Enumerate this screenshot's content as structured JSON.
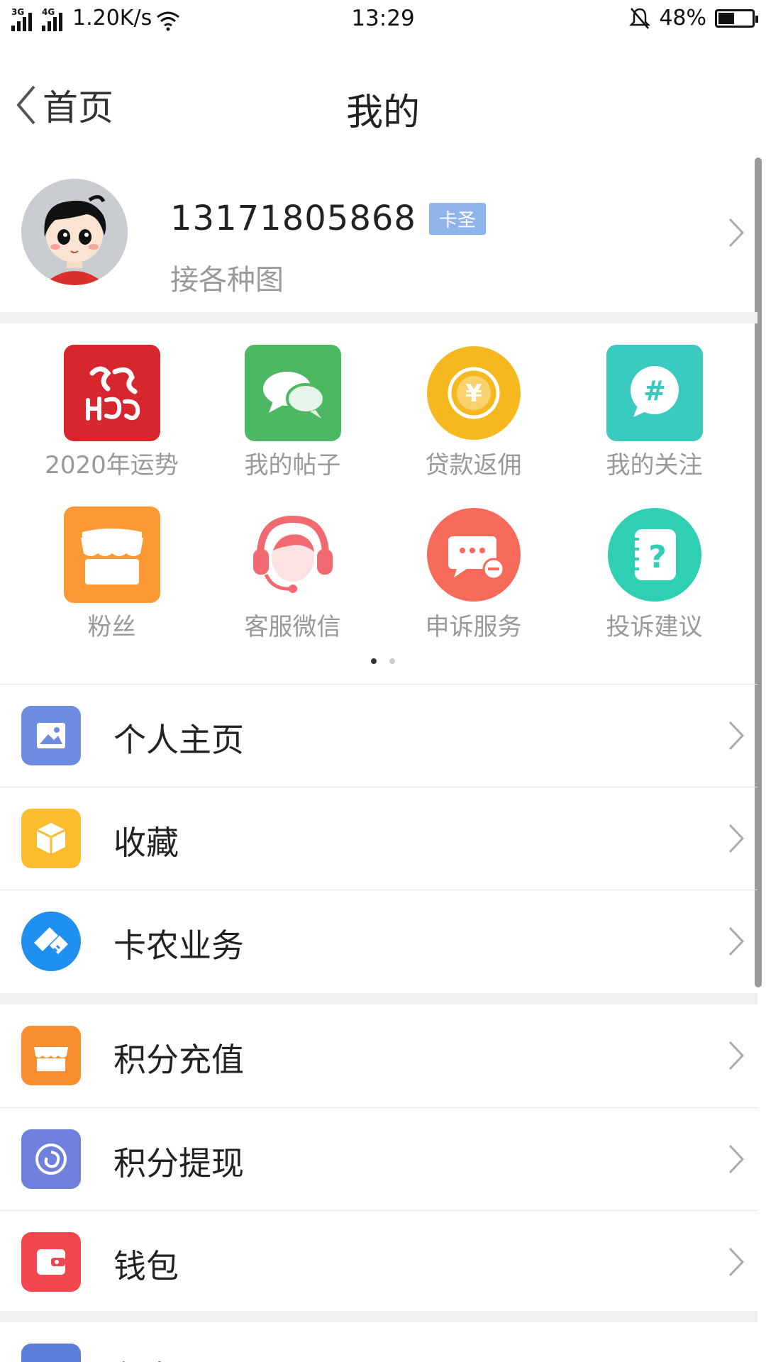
{
  "status_bar": {
    "net1": "3G",
    "net2": "4G",
    "speed": "1.20K/s",
    "time": "13:29",
    "battery": "48%",
    "battery_level": 0.48
  },
  "nav": {
    "back_label": "首页",
    "title": "我的"
  },
  "profile": {
    "phone": "13171805868",
    "tag": "卡圣",
    "subtitle": "接各种图"
  },
  "grid": [
    {
      "label": "2020年运势",
      "icon": "rat-zodiac-icon",
      "color": "#d8262e"
    },
    {
      "label": "我的帖子",
      "icon": "chat-bubbles-icon",
      "color": "#4cb861"
    },
    {
      "label": "贷款返佣",
      "icon": "yen-coin-icon",
      "color": "#f6b81f"
    },
    {
      "label": "我的关注",
      "icon": "hashtag-bubble-icon",
      "color": "#38c9bf"
    },
    {
      "label": "粉丝",
      "icon": "shop-icon",
      "color": "#fb9a35"
    },
    {
      "label": "客服微信",
      "icon": "headset-agent-icon",
      "color": "#f16a72"
    },
    {
      "label": "申诉服务",
      "icon": "message-minus-icon",
      "color": "#f66a5a"
    },
    {
      "label": "投诉建议",
      "icon": "question-notebook-icon",
      "color": "#2fcfb3"
    }
  ],
  "list_group1": [
    {
      "label": "个人主页",
      "icon": "image-icon",
      "color": "#6c8de0"
    },
    {
      "label": "收藏",
      "icon": "box-icon",
      "color": "#fbbd2e"
    },
    {
      "label": "卡农业务",
      "icon": "handshake-icon",
      "color": "#1f8ff0"
    }
  ],
  "list_group2": [
    {
      "label": "积分充值",
      "icon": "store-icon",
      "color": "#f98e2f"
    },
    {
      "label": "积分提现",
      "icon": "spiral-icon",
      "color": "#6f7fdc"
    },
    {
      "label": "钱包",
      "icon": "wallet-icon",
      "color": "#f2474f"
    },
    {
      "label": "任务",
      "icon": "task-icon",
      "color": "#5b7cd8"
    }
  ]
}
